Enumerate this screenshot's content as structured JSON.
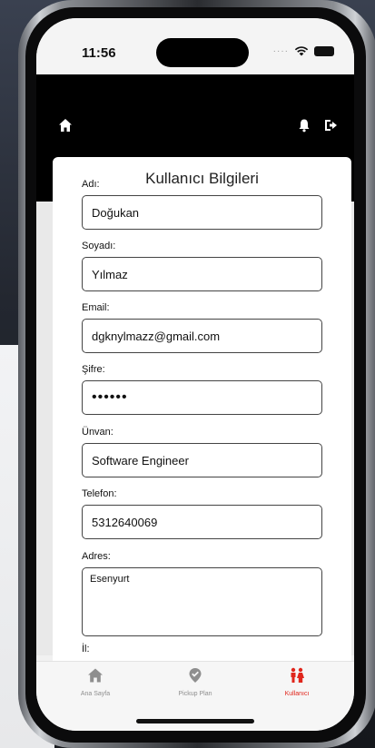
{
  "status": {
    "time": "11:56"
  },
  "card": {
    "title": "Kullanıcı Bilgileri",
    "fields": [
      {
        "label": "Adı:",
        "value": "Doğukan"
      },
      {
        "label": "Soyadı:",
        "value": "Yılmaz"
      },
      {
        "label": "Email:",
        "value": "dgknylmazz@gmail.com"
      },
      {
        "label": "Şifre:",
        "value": "••••••"
      },
      {
        "label": "Ünvan:",
        "value": "Software Engineer"
      },
      {
        "label": "Telefon:",
        "value": "5312640069"
      },
      {
        "label": "Adres:",
        "value": "Esenyurt"
      },
      {
        "label": "İl:",
        "value": ""
      }
    ]
  },
  "tabs": [
    {
      "label": "Ana Sayfa",
      "icon": "home-icon"
    },
    {
      "label": "Pickup Plan",
      "icon": "map-pin-check-icon"
    },
    {
      "label": "Kullanıcı",
      "icon": "users-icon"
    }
  ],
  "colors": {
    "accent": "#e0261c",
    "header": "#000000",
    "inactive": "#8e8e8e"
  }
}
